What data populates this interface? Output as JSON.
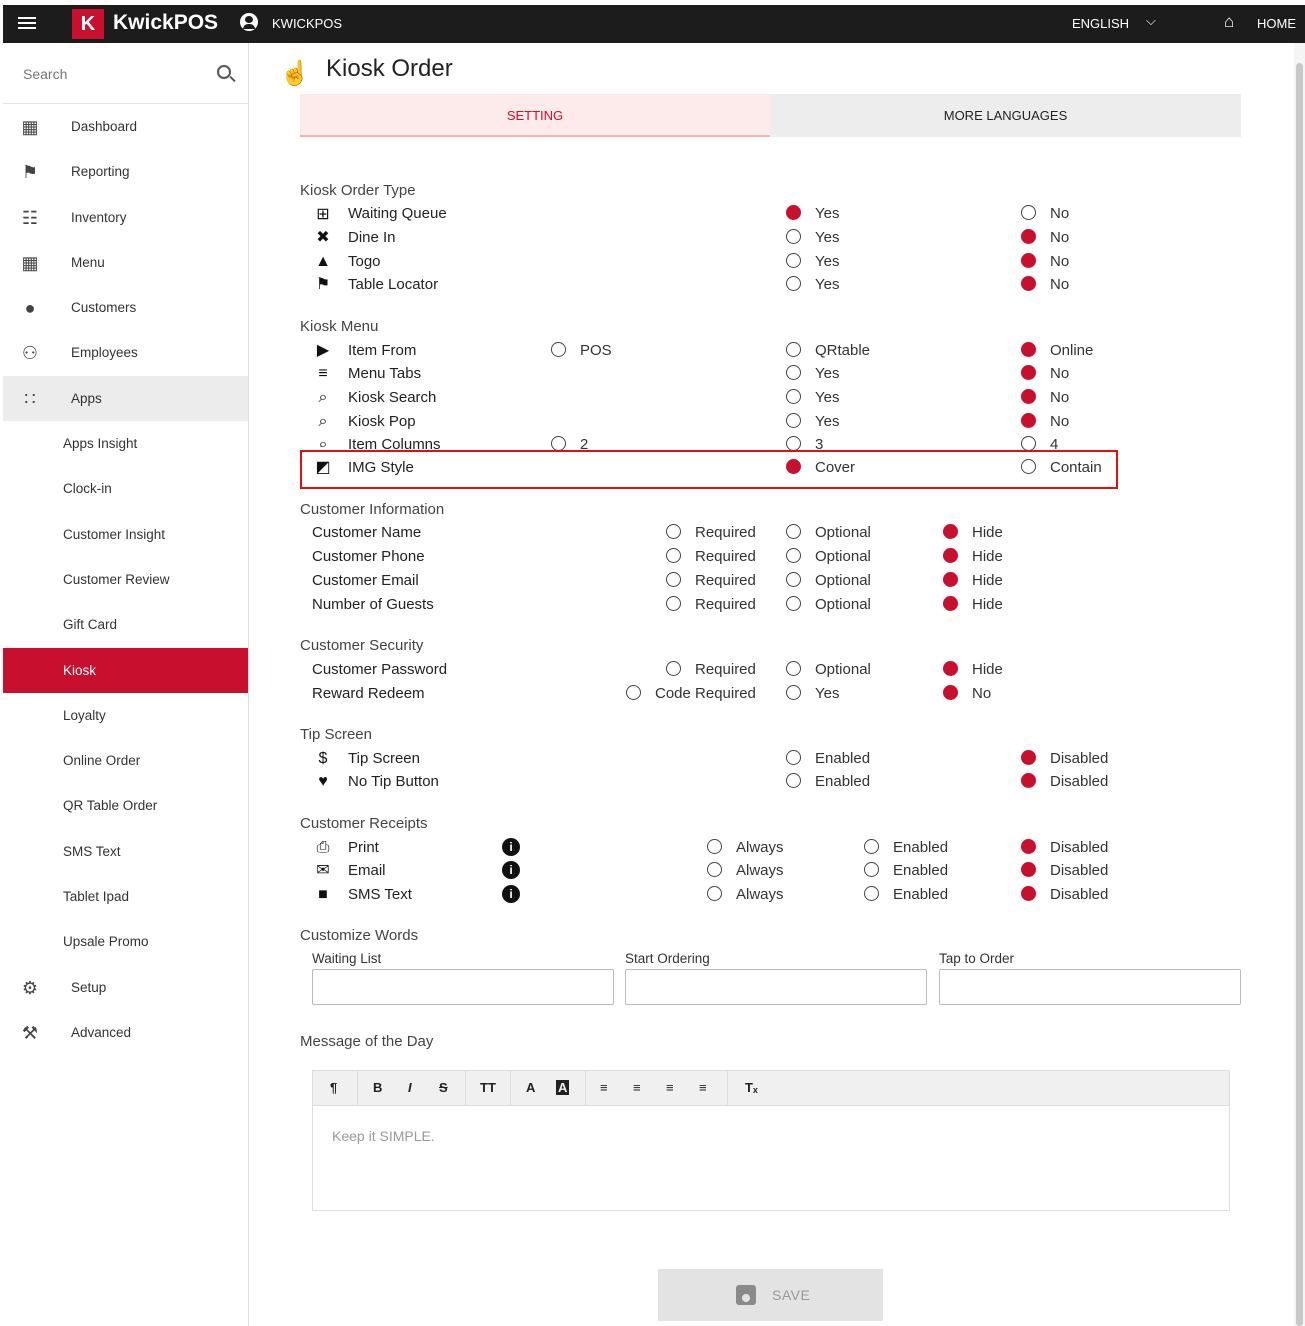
{
  "topbar": {
    "logo_letter": "K",
    "logo_text": "KwickPOS",
    "user_name": "KWICKPOS",
    "language": "ENGLISH",
    "home": "HOME"
  },
  "sidebar": {
    "search_placeholder": "Search",
    "items": [
      {
        "label": "Dashboard",
        "icon": "dashboard-icon"
      },
      {
        "label": "Reporting",
        "icon": "reporting-icon"
      },
      {
        "label": "Inventory",
        "icon": "clipboard-icon"
      },
      {
        "label": "Menu",
        "icon": "grid-icon"
      },
      {
        "label": "Customers",
        "icon": "user-circle-icon"
      },
      {
        "label": "Employees",
        "icon": "people-icon"
      },
      {
        "label": "Apps",
        "icon": "apps-icon"
      }
    ],
    "apps_sub": [
      "Apps Insight",
      "Clock-in",
      "Customer Insight",
      "Customer Review",
      "Gift Card",
      "Kiosk",
      "Loyalty",
      "Online Order",
      "QR Table Order",
      "SMS Text",
      "Tablet Ipad",
      "Upsale Promo"
    ],
    "bottom": [
      {
        "label": "Setup",
        "icon": "gear-icon"
      },
      {
        "label": "Advanced",
        "icon": "wrench-icon"
      }
    ],
    "active": "Kiosk"
  },
  "page": {
    "title": "Kiosk Order",
    "tab_setting": "SETTING",
    "tab_languages": "MORE LANGUAGES"
  },
  "order_type": {
    "title": "Kiosk Order Type",
    "rows": [
      {
        "label": "Waiting Queue",
        "yes": "Yes",
        "no": "No",
        "selected": "yes"
      },
      {
        "label": "Dine In",
        "yes": "Yes",
        "no": "No",
        "selected": "no"
      },
      {
        "label": "Togo",
        "yes": "Yes",
        "no": "No",
        "selected": "no"
      },
      {
        "label": "Table Locator",
        "yes": "Yes",
        "no": "No",
        "selected": "no"
      }
    ]
  },
  "kiosk_menu": {
    "title": "Kiosk Menu",
    "item_from": {
      "label": "Item From",
      "opts": [
        "POS",
        "QRtable",
        "Online"
      ],
      "selected": "Online"
    },
    "menu_tabs": {
      "label": "Menu Tabs",
      "opts": [
        "Yes",
        "No"
      ],
      "selected": "No"
    },
    "kiosk_search": {
      "label": "Kiosk Search",
      "opts": [
        "Yes",
        "No"
      ],
      "selected": "No"
    },
    "kiosk_pop": {
      "label": "Kiosk Pop",
      "opts": [
        "Yes",
        "No"
      ],
      "selected": "No"
    },
    "item_columns": {
      "label": "Item Columns",
      "opts": [
        "2",
        "3",
        "4"
      ]
    },
    "img_style": {
      "label": "IMG Style",
      "opts": [
        "Cover",
        "Contain"
      ],
      "selected": "Cover"
    }
  },
  "customer_info": {
    "title": "Customer Information",
    "rows": [
      {
        "label": "Customer Name",
        "r": "Required",
        "o": "Optional",
        "h": "Hide"
      },
      {
        "label": "Customer Phone",
        "r": "Required",
        "o": "Optional",
        "h": "Hide"
      },
      {
        "label": "Customer Email",
        "r": "Required",
        "o": "Optional",
        "h": "Hide"
      },
      {
        "label": "Number of Guests",
        "r": "Required",
        "o": "Optional",
        "h": "Hide"
      }
    ]
  },
  "customer_security": {
    "title": "Customer Security",
    "password": {
      "label": "Customer Password",
      "r": "Required",
      "o": "Optional",
      "h": "Hide"
    },
    "reward": {
      "label": "Reward Redeem",
      "r": "Code Required",
      "o": "Yes",
      "h": "No"
    }
  },
  "tip_screen": {
    "title": "Tip Screen",
    "rows": [
      {
        "label": "Tip Screen",
        "e": "Enabled",
        "d": "Disabled"
      },
      {
        "label": "No Tip Button",
        "e": "Enabled",
        "d": "Disabled"
      }
    ]
  },
  "receipts": {
    "title": "Customer Receipts",
    "rows": [
      {
        "label": "Print",
        "a": "Always",
        "e": "Enabled",
        "d": "Disabled"
      },
      {
        "label": "Email",
        "a": "Always",
        "e": "Enabled",
        "d": "Disabled"
      },
      {
        "label": "SMS Text",
        "a": "Always",
        "e": "Enabled",
        "d": "Disabled"
      }
    ]
  },
  "customize_words": {
    "title": "Customize Words",
    "waiting_list": "Waiting List",
    "start_ordering": "Start Ordering",
    "tap_to_order": "Tap to Order"
  },
  "motd": {
    "title": "Message of the Day",
    "placeholder": "Keep it SIMPLE."
  },
  "save_label": "SAVE",
  "colors": {
    "accent": "#c8102e",
    "topbar": "#1c1c1c"
  }
}
